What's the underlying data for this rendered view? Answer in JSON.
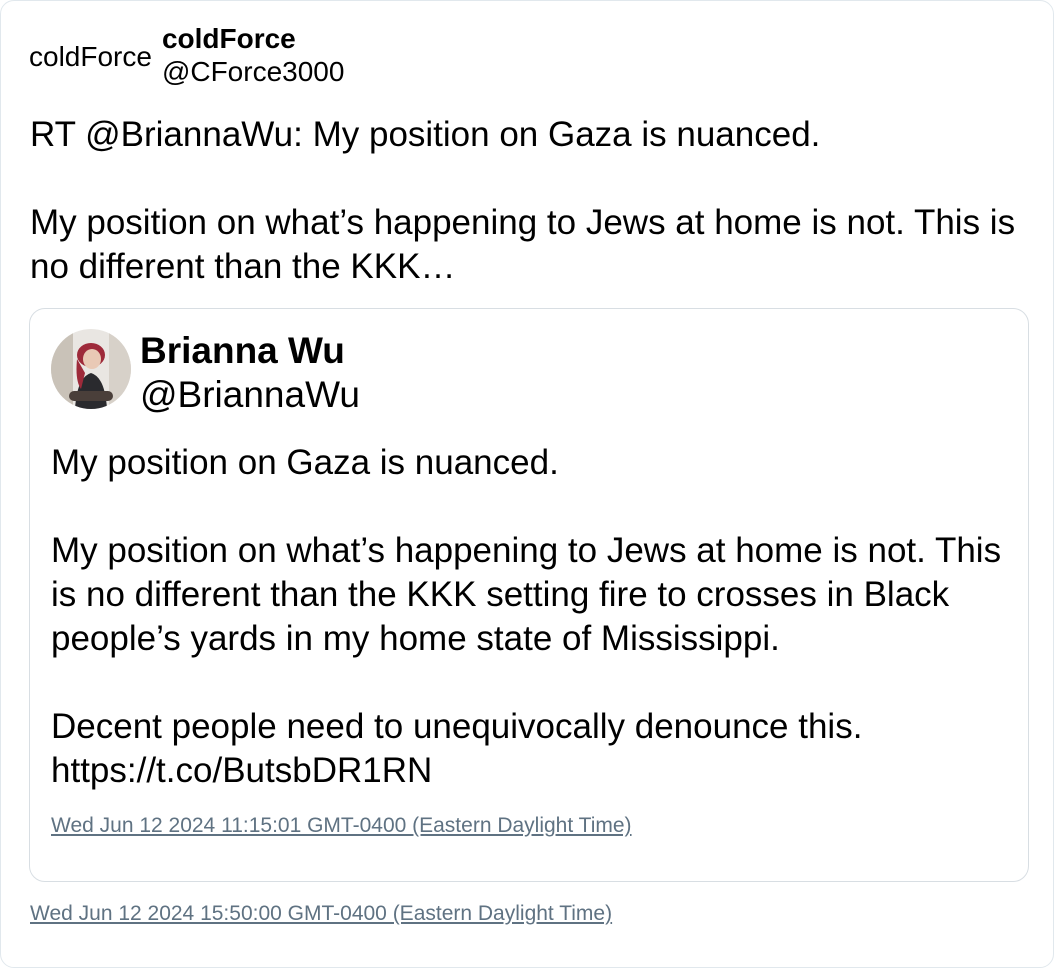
{
  "tweet": {
    "avatar_alt": "coldForce",
    "display_name": "coldForce",
    "handle": "@CForce3000",
    "text": "RT @BriannaWu: My position on Gaza is nuanced.\n\nMy position on what’s happening to Jews at home is not. This is no different than the KKK…",
    "timestamp": "Wed Jun 12 2024 15:50:00 GMT-0400 (Eastern Daylight Time)"
  },
  "quoted_tweet": {
    "avatar_icon": "profile-photo",
    "display_name": "Brianna Wu",
    "handle": "@BriannaWu",
    "text": "My position on Gaza is nuanced.\n\nMy position on what’s happening to Jews at home is not. This is no different than the KKK setting fire to crosses in Black people’s yards in my home state of Mississippi.\n\nDecent people need to unequivocally denounce this. https://t.co/ButsbDR1RN",
    "timestamp": "Wed Jun 12 2024 11:15:01 GMT-0400 (Eastern Daylight Time)"
  },
  "colors": {
    "border": "#e1e8ed",
    "timestamp": "#5f7282"
  }
}
